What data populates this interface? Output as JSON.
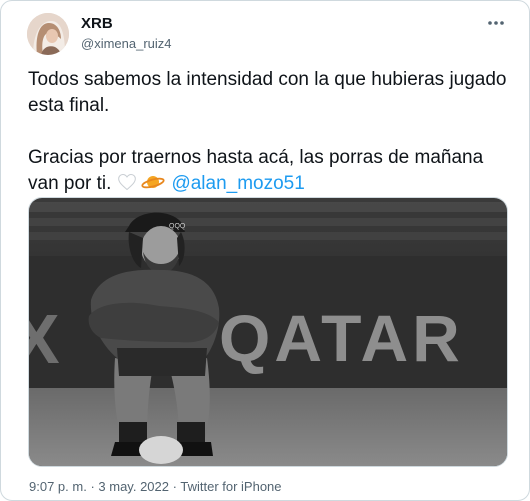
{
  "author": {
    "display_name": "XRB",
    "handle": "@ximena_ruiz4"
  },
  "tweet": {
    "paragraph1": "Todos sabemos la intensidad con la que hubieras jugado esta final.",
    "paragraph2_text": "Gracias por traernos hasta acá, las porras de mañana van por ti.",
    "mention": "@alan_mozo51",
    "emojis": [
      "white-heart-icon",
      "ringed-planet-icon"
    ]
  },
  "media": {
    "banner_text": "QATAR",
    "banner_partial_letter": "X",
    "cap_text": "QQQ",
    "style": "black-and-white photo"
  },
  "meta": {
    "time": "9:07 p. m.",
    "separator1": "·",
    "date": "3 may. 2022",
    "separator2": "·",
    "source": "Twitter for iPhone"
  },
  "colors": {
    "link": "#1d9bf0",
    "secondary_text": "#536471",
    "border": "#cfd9de"
  }
}
